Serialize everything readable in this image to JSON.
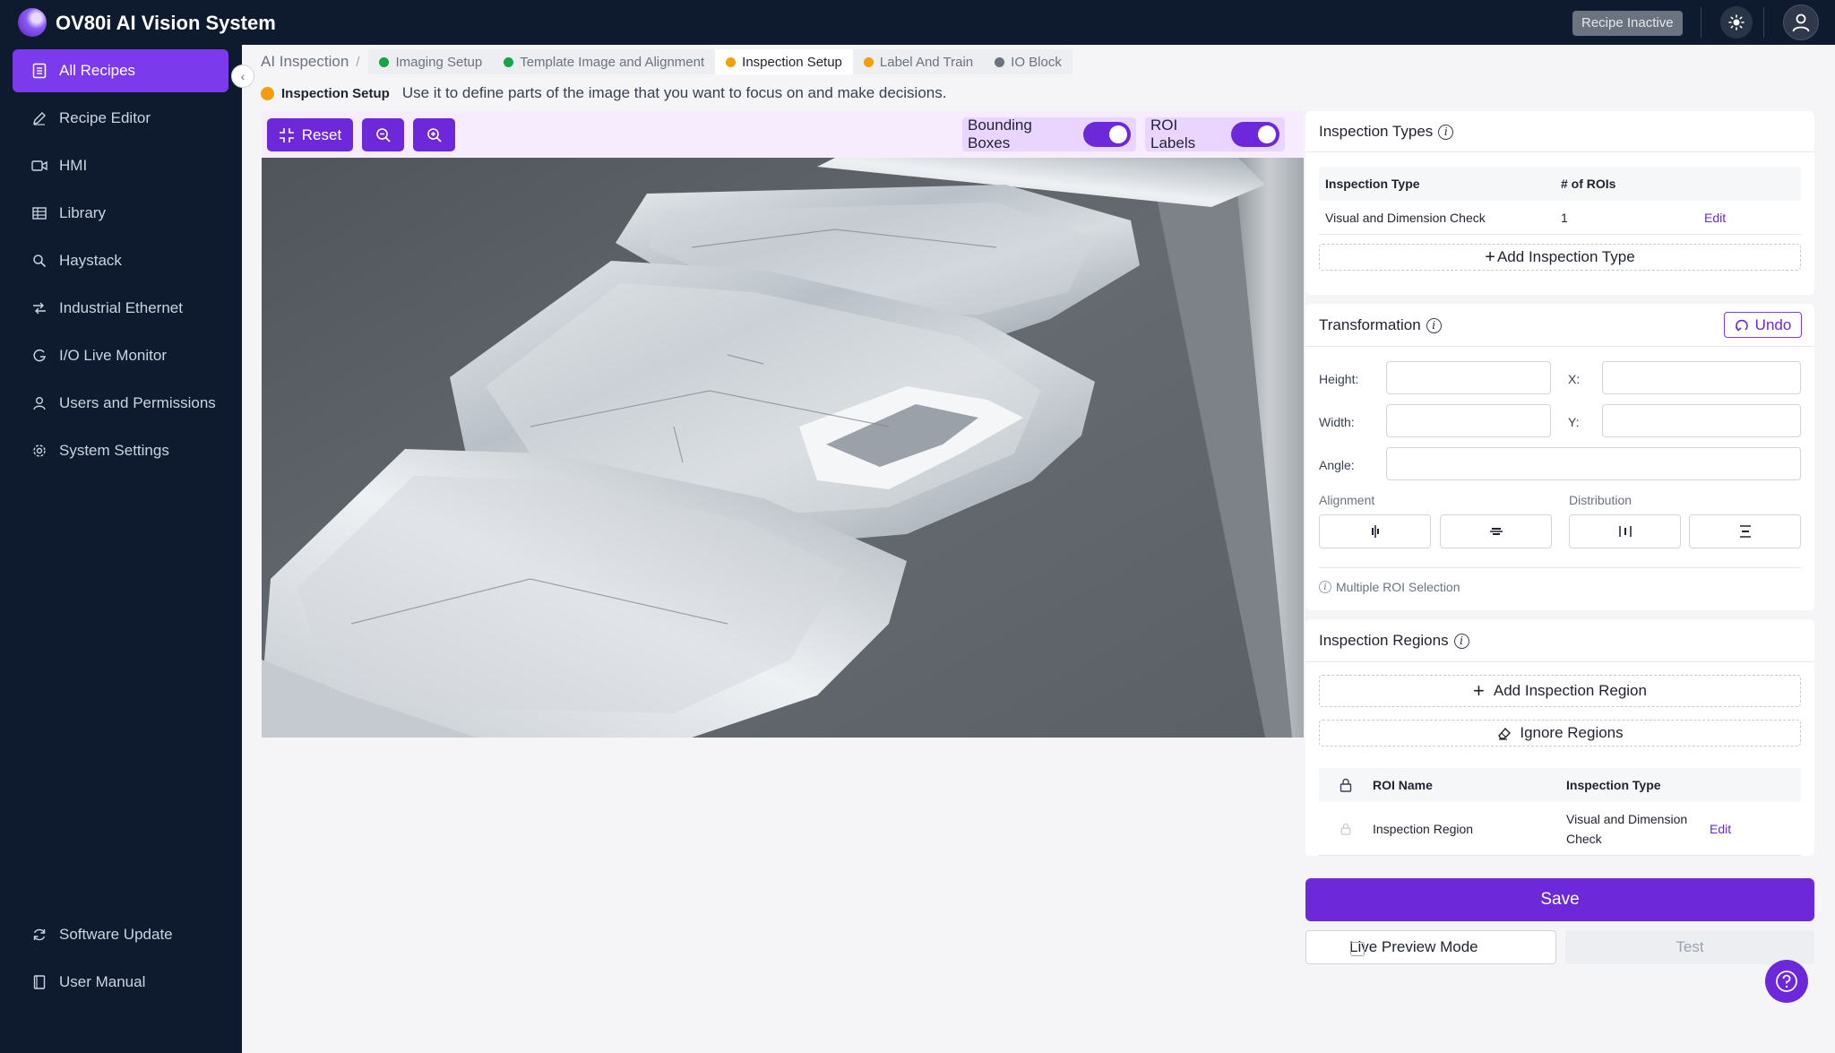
{
  "app": {
    "title": "OV80i AI Vision System",
    "status_badge": "Recipe Inactive"
  },
  "sidebar": {
    "items": [
      {
        "label": "All Recipes",
        "icon": "recipe-list-icon",
        "active": true
      },
      {
        "label": "Recipe Editor",
        "icon": "pencil-icon"
      },
      {
        "label": "HMI",
        "icon": "video-icon"
      },
      {
        "label": "Library",
        "icon": "grid-icon"
      },
      {
        "label": "Haystack",
        "icon": "search-icon"
      },
      {
        "label": "Industrial Ethernet",
        "icon": "network-icon"
      },
      {
        "label": "I/O Live Monitor",
        "icon": "monitor-icon"
      },
      {
        "label": "Users and Permissions",
        "icon": "user-icon"
      },
      {
        "label": "System Settings",
        "icon": "gear-icon"
      }
    ],
    "bottom": [
      {
        "label": "Software Update",
        "icon": "refresh-icon"
      },
      {
        "label": "User Manual",
        "icon": "book-icon"
      }
    ]
  },
  "breadcrumb": {
    "root": "AI Inspection",
    "separator": "/",
    "steps": [
      {
        "label": "Imaging Setup",
        "status": "green"
      },
      {
        "label": "Template Image and Alignment",
        "status": "green"
      },
      {
        "label": "Inspection Setup",
        "status": "orange",
        "current": true
      },
      {
        "label": "Label And Train",
        "status": "orange"
      },
      {
        "label": "IO Block",
        "status": "gray"
      }
    ]
  },
  "subtitle": {
    "title": "Inspection Setup",
    "text": "Use it to define parts of the image that you want to focus on and make decisions."
  },
  "toolbar": {
    "reset_label": "Reset",
    "bounding_boxes_label": "Bounding Boxes",
    "bounding_boxes_on": true,
    "roi_labels_label": "ROI Labels",
    "roi_labels_on": true
  },
  "inspection_types": {
    "title": "Inspection Types",
    "columns": [
      "Inspection Type",
      "# of ROIs"
    ],
    "rows": [
      {
        "type": "Visual and Dimension Check",
        "rois": "1",
        "action": "Edit"
      }
    ],
    "add_label": "Add Inspection Type"
  },
  "transformation": {
    "title": "Transformation",
    "undo_label": "Undo",
    "fields": {
      "height": "Height:",
      "width": "Width:",
      "x": "X:",
      "y": "Y:",
      "angle": "Angle:"
    },
    "values": {
      "height": "",
      "width": "",
      "x": "",
      "y": "",
      "angle": ""
    },
    "alignment_label": "Alignment",
    "distribution_label": "Distribution",
    "hint": "Multiple ROI Selection"
  },
  "inspection_regions": {
    "title": "Inspection Regions",
    "add_label": "Add Inspection Region",
    "ignore_label": "Ignore Regions",
    "columns": [
      "ROI Name",
      "Inspection Type"
    ],
    "rows": [
      {
        "name": "Inspection Region",
        "type": "Visual and Dimension Check",
        "action": "Edit"
      }
    ]
  },
  "actions": {
    "save_label": "Save",
    "live_preview_label": "Live Preview Mode",
    "live_preview_checked": false,
    "test_label": "Test"
  },
  "colors": {
    "accent": "#6d28d9",
    "topbar": "#0e1a2e",
    "step_green": "#16a34a",
    "step_orange": "#f59e0b"
  }
}
